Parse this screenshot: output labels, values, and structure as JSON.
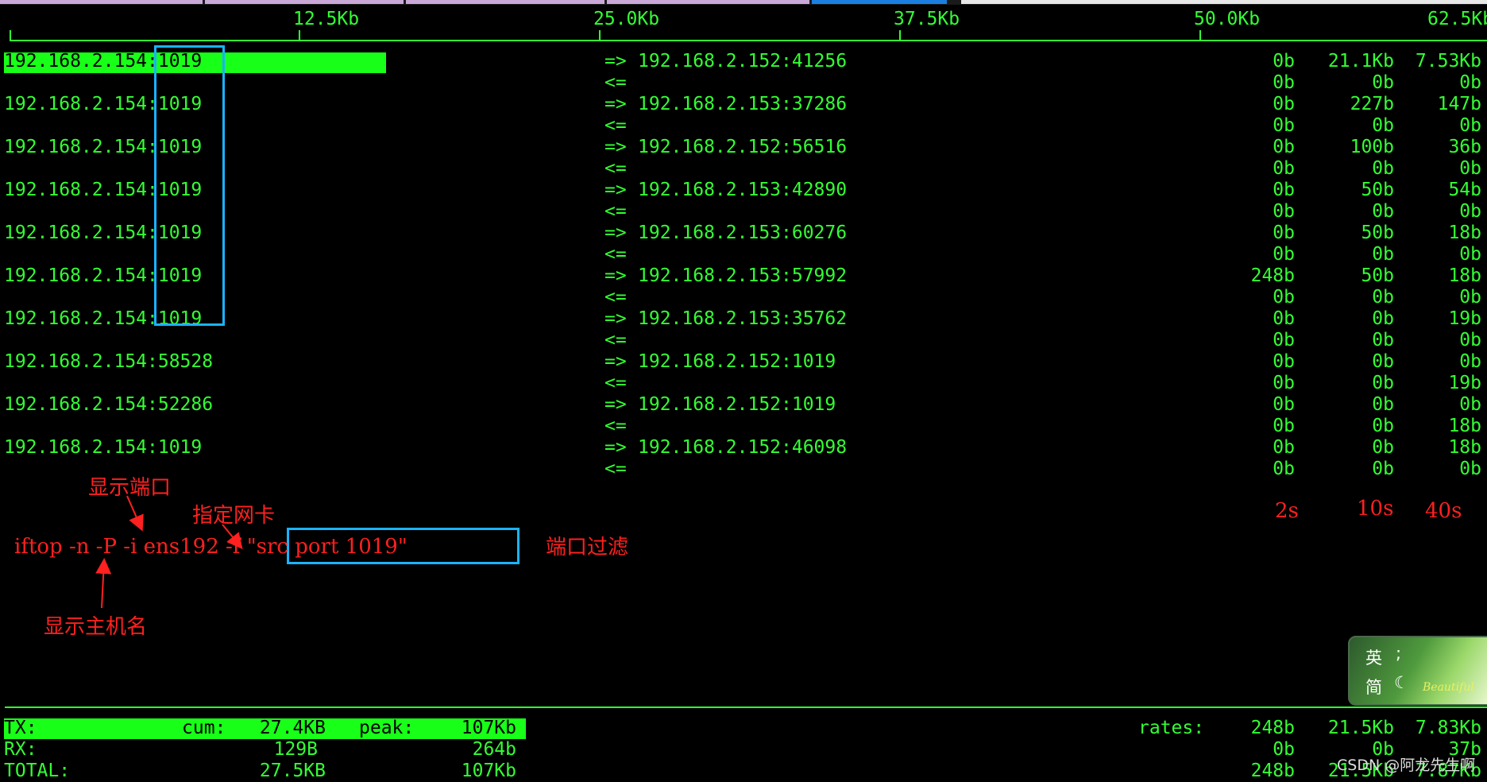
{
  "scale": {
    "labels": [
      "12.5Kb",
      "25.0Kb",
      "37.5Kb",
      "50.0Kb",
      "62.5Kb"
    ]
  },
  "connections": [
    {
      "src": "192.168.2.154:1019",
      "dst": "192.168.2.152:41256",
      "out": [
        "0b",
        "21.1Kb",
        "7.53Kb"
      ],
      "in": [
        "0b",
        "0b",
        "0b"
      ]
    },
    {
      "src": "192.168.2.154:1019",
      "dst": "192.168.2.153:37286",
      "out": [
        "0b",
        "227b",
        "147b"
      ],
      "in": [
        "0b",
        "0b",
        "0b"
      ]
    },
    {
      "src": "192.168.2.154:1019",
      "dst": "192.168.2.152:56516",
      "out": [
        "0b",
        "100b",
        "36b"
      ],
      "in": [
        "0b",
        "0b",
        "0b"
      ]
    },
    {
      "src": "192.168.2.154:1019",
      "dst": "192.168.2.153:42890",
      "out": [
        "0b",
        "50b",
        "54b"
      ],
      "in": [
        "0b",
        "0b",
        "0b"
      ]
    },
    {
      "src": "192.168.2.154:1019",
      "dst": "192.168.2.153:60276",
      "out": [
        "0b",
        "50b",
        "18b"
      ],
      "in": [
        "0b",
        "0b",
        "0b"
      ]
    },
    {
      "src": "192.168.2.154:1019",
      "dst": "192.168.2.153:57992",
      "out": [
        "248b",
        "50b",
        "18b"
      ],
      "in": [
        "0b",
        "0b",
        "0b"
      ]
    },
    {
      "src": "192.168.2.154:1019",
      "dst": "192.168.2.153:35762",
      "out": [
        "0b",
        "0b",
        "19b"
      ],
      "in": [
        "0b",
        "0b",
        "0b"
      ]
    },
    {
      "src": "192.168.2.154:58528",
      "dst": "192.168.2.152:1019",
      "out": [
        "0b",
        "0b",
        "0b"
      ],
      "in": [
        "0b",
        "0b",
        "19b"
      ]
    },
    {
      "src": "192.168.2.154:52286",
      "dst": "192.168.2.152:1019",
      "out": [
        "0b",
        "0b",
        "0b"
      ],
      "in": [
        "0b",
        "0b",
        "18b"
      ]
    },
    {
      "src": "192.168.2.154:1019",
      "dst": "192.168.2.152:46098",
      "out": [
        "0b",
        "0b",
        "18b"
      ],
      "in": [
        "0b",
        "0b",
        "0b"
      ]
    }
  ],
  "top_bar_fraction": 0.2585,
  "symbols": {
    "out": "=>",
    "in": "<="
  },
  "annotations": {
    "show_port": "显示端口",
    "choose_nic": "指定网卡",
    "command": "iftop -n -P -i ens192 -f \"src port 1019\"",
    "port_filter": "端口过滤",
    "show_hostname": "显示主机名",
    "t2": "2s",
    "t10": "10s",
    "t40": "40s"
  },
  "totals": {
    "tx_label": "TX:",
    "rx_label": "RX:",
    "total_label": "TOTAL:",
    "cum_label": "cum:",
    "peak_label": "peak:",
    "rates_label": "rates:",
    "tx_cum": "27.4KB",
    "rx_cum": "129B",
    "total_cum": "27.5KB",
    "tx_peak": "107Kb",
    "rx_peak": "264b",
    "total_peak": "107Kb",
    "tx_rates": [
      "248b",
      "21.5Kb",
      "7.83Kb"
    ],
    "rx_rates": [
      "0b",
      "0b",
      "37b"
    ],
    "total_rates": [
      "248b",
      "21.5Kb",
      "7.87Kb"
    ]
  },
  "ime": {
    "lang": "英",
    "punct": ";",
    "mode": "简",
    "moon": "☾",
    "brand": "Beautiful"
  },
  "watermark": "CSDN @阿龙先生啊",
  "colors": {
    "terminal_green": "#33ff33",
    "bar_green": "#18ff18",
    "annotation_red": "#ff2020",
    "highlight_box": "#1ab3ff"
  }
}
